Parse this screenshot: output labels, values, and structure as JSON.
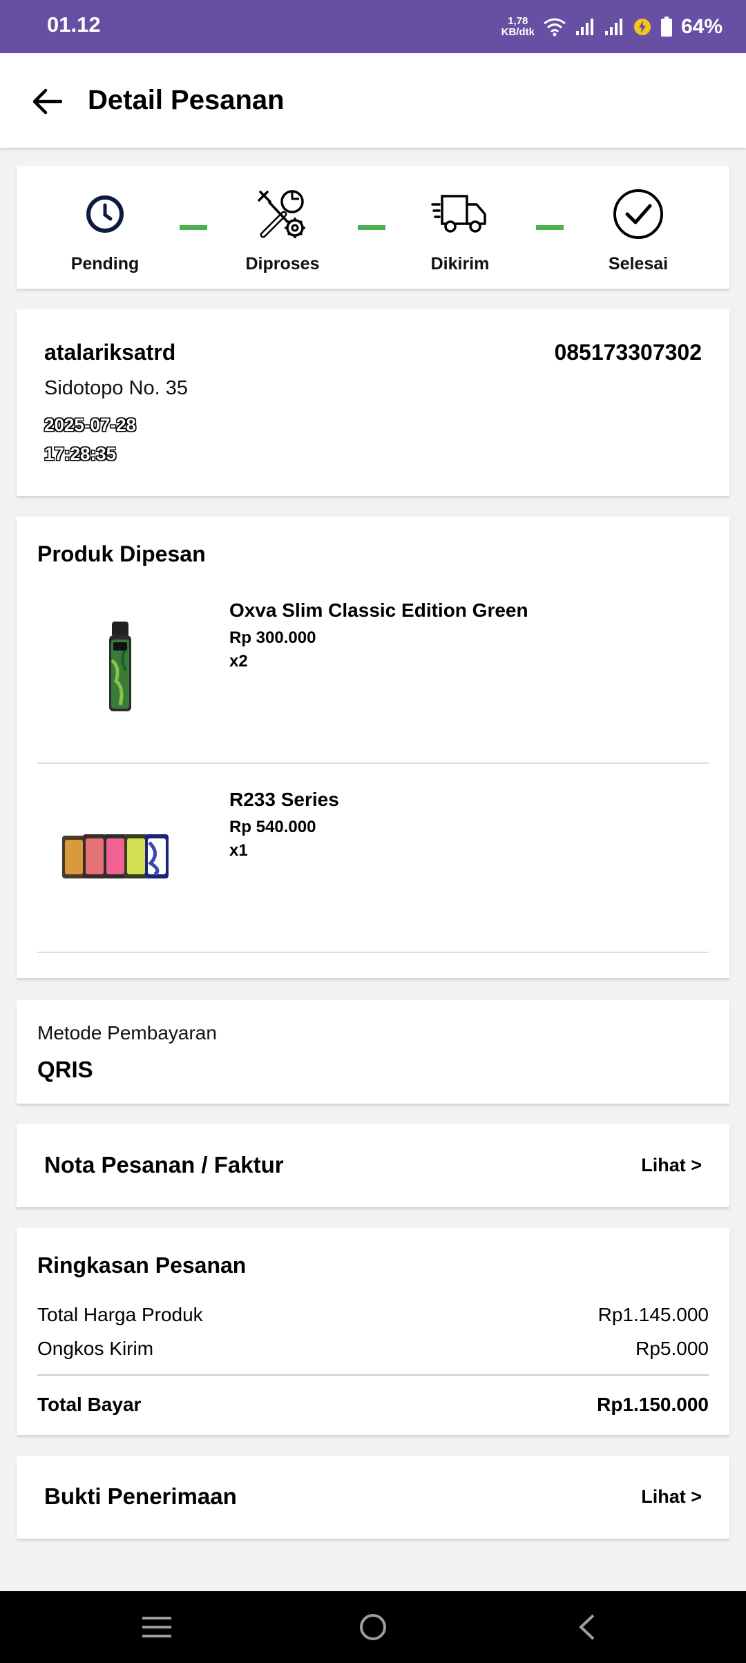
{
  "status_bar": {
    "time": "01.12",
    "speed_value": "1,78",
    "speed_unit": "KB/dtk",
    "battery": "64%"
  },
  "header": {
    "title": "Detail Pesanan"
  },
  "tracking": {
    "steps": [
      {
        "label": "Pending",
        "icon": "clock-icon"
      },
      {
        "label": "Diproses",
        "icon": "tools-icon"
      },
      {
        "label": "Dikirim",
        "icon": "truck-icon"
      },
      {
        "label": "Selesai",
        "icon": "check-circle-icon"
      }
    ],
    "connector_color": "#4caf50"
  },
  "address": {
    "name": "atalariksatrd",
    "phone": "085173307302",
    "street": "Sidotopo No. 35",
    "date": "2025-07-28",
    "time": "17:28:35"
  },
  "products": {
    "title": "Produk Dipesan",
    "items": [
      {
        "name": "Oxva Slim Classic Edition Green",
        "price": "Rp 300.000",
        "qty": "x2",
        "image": "pod-device-image"
      },
      {
        "name": "R233 Series",
        "price": "Rp 540.000",
        "qty": "x1",
        "image": "mod-box-image"
      }
    ]
  },
  "payment": {
    "label": "Metode Pembayaran",
    "value": "QRIS"
  },
  "invoice": {
    "title": "Nota Pesanan / Faktur",
    "link": "Lihat >"
  },
  "summary": {
    "title": "Ringkasan Pesanan",
    "rows": [
      {
        "label": "Total Harga Produk",
        "value": "Rp1.145.000"
      },
      {
        "label": "Ongkos Kirim",
        "value": "Rp5.000"
      }
    ],
    "total_label": "Total Bayar",
    "total_value": "Rp1.150.000"
  },
  "receipt": {
    "title": "Bukti Penerimaan",
    "link": "Lihat >"
  },
  "colors": {
    "status_bar": "#6750a4",
    "accent_green": "#4caf50",
    "nav_bar": "#000000"
  }
}
